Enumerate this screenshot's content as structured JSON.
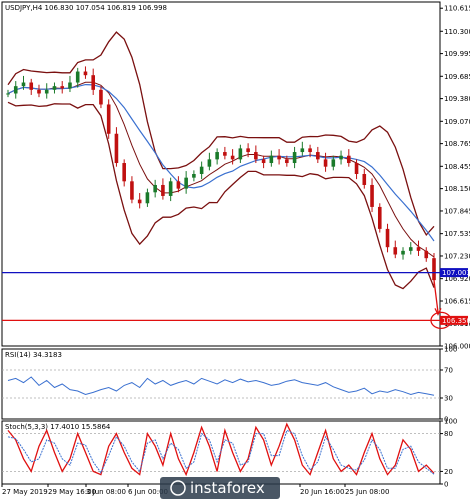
{
  "chart_data": [
    {
      "type": "candlestick",
      "header": "USDJPY,H4  106.830 107.054 106.819 106.998",
      "y_ticks": [
        "110.615",
        "110.300",
        "109.995",
        "109.685",
        "109.380",
        "109.070",
        "108.765",
        "108.455",
        "108.150",
        "107.845",
        "107.535",
        "107.230",
        "106.920",
        "106.615",
        "106.310",
        "106.000"
      ],
      "ylim": [
        106.0,
        110.7
      ],
      "x_ticks": [
        "27 May 2019",
        "29 May 16:00",
        "3 Jun 08:00",
        "6 Jun 00:00",
        "20 Jun 16:00",
        "25 Jun 08:00"
      ],
      "price_path": [
        109.45,
        109.55,
        109.6,
        109.5,
        109.45,
        109.5,
        109.55,
        109.52,
        109.6,
        109.75,
        109.7,
        109.5,
        109.3,
        108.9,
        108.5,
        108.25,
        108.0,
        107.95,
        108.1,
        108.2,
        108.05,
        108.25,
        108.15,
        108.3,
        108.35,
        108.45,
        108.55,
        108.65,
        108.6,
        108.55,
        108.7,
        108.65,
        108.55,
        108.5,
        108.6,
        108.55,
        108.5,
        108.65,
        108.7,
        108.65,
        108.55,
        108.45,
        108.55,
        108.6,
        108.5,
        108.35,
        108.2,
        107.9,
        107.6,
        107.35,
        107.25,
        107.3,
        107.35,
        107.3,
        107.2,
        106.9
      ],
      "horizontal_levels": [
        {
          "label": "107.003",
          "value": 107.003,
          "color": "#1010c0"
        },
        {
          "label": "106.350",
          "value": 106.35,
          "color": "#e01010"
        }
      ],
      "colors": {
        "bullish": "#1a7a2a",
        "bearish": "#c01010",
        "bands": "#7a1010",
        "ma": "#3a70d0"
      }
    },
    {
      "type": "line",
      "header": "RSI(14) 34.3183",
      "y_ticks": [
        "100",
        "70",
        "30",
        "0"
      ],
      "ylim": [
        0,
        100
      ],
      "values": [
        55,
        58,
        52,
        60,
        48,
        55,
        45,
        50,
        42,
        40,
        35,
        38,
        42,
        45,
        40,
        48,
        52,
        45,
        58,
        50,
        55,
        48,
        52,
        55,
        50,
        58,
        54,
        50,
        56,
        52,
        57,
        53,
        55,
        52,
        48,
        50,
        54,
        56,
        52,
        50,
        48,
        52,
        46,
        42,
        38,
        40,
        44,
        36,
        40,
        38,
        42,
        39,
        35,
        38,
        36,
        34
      ],
      "colors": {
        "line": "#3a70d0"
      }
    },
    {
      "type": "line",
      "header": "Stoch(5,3,3) 17.4010 15.5864",
      "y_ticks": [
        "100",
        "80",
        "20",
        "0"
      ],
      "ylim": [
        0,
        100
      ],
      "series": [
        {
          "name": "main",
          "values": [
            85,
            70,
            40,
            20,
            60,
            85,
            50,
            20,
            40,
            80,
            50,
            20,
            15,
            60,
            80,
            50,
            25,
            15,
            80,
            60,
            30,
            80,
            40,
            15,
            50,
            90,
            60,
            20,
            85,
            50,
            20,
            40,
            90,
            70,
            30,
            60,
            95,
            70,
            30,
            15,
            50,
            85,
            40,
            20,
            30,
            15,
            50,
            80,
            40,
            15,
            30,
            70,
            55,
            20,
            30,
            17
          ]
        },
        {
          "name": "signal",
          "values": [
            75,
            72,
            55,
            35,
            40,
            70,
            65,
            40,
            30,
            65,
            62,
            35,
            18,
            45,
            75,
            60,
            35,
            20,
            65,
            70,
            40,
            65,
            55,
            25,
            35,
            80,
            70,
            35,
            70,
            65,
            30,
            35,
            80,
            80,
            45,
            45,
            85,
            80,
            45,
            22,
            35,
            75,
            55,
            30,
            25,
            22,
            38,
            70,
            55,
            25,
            25,
            55,
            60,
            35,
            25,
            15.6
          ]
        }
      ],
      "colors": {
        "main": "#e01010",
        "signal": "#3a70d0"
      }
    }
  ],
  "watermark": {
    "text": "instaforex"
  }
}
